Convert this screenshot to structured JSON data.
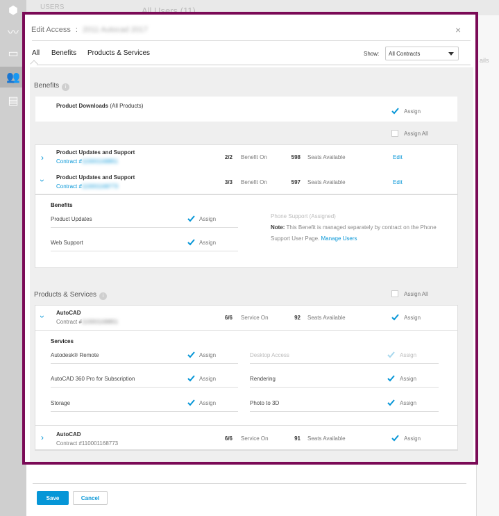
{
  "background": {
    "users_label": "USERS",
    "all_users_label": "All Users (11)",
    "right_col_text": "ails"
  },
  "dialog": {
    "title": "Edit Access",
    "title_sep": ":",
    "title_suffix": "2011 Autocad 2017",
    "close": "×",
    "tabs": [
      "All",
      "Benefits",
      "Products & Services"
    ],
    "show_label": "Show:",
    "show_value": "All Contracts"
  },
  "benefits": {
    "heading": "Benefits",
    "downloads_name": "Product Downloads",
    "downloads_suffix": " (All Products)",
    "assign_label": "Assign",
    "assign_all_label": "Assign All",
    "rows": [
      {
        "name": "Product Updates and Support",
        "contract_prefix": "Contract #",
        "contract_num": "110001168851",
        "count": "2/2",
        "status": "Benefit On",
        "seats": "598",
        "seats_label": "Seats Available",
        "action": "Edit"
      },
      {
        "name": "Product Updates and Support",
        "contract_prefix": "Contract #",
        "contract_num": "110001168773",
        "count": "3/3",
        "status": "Benefit On",
        "seats": "597",
        "seats_label": "Seats Available",
        "action": "Edit"
      }
    ],
    "detail": {
      "title": "Benefits",
      "items": [
        {
          "label": "Product Updates",
          "assign": "Assign"
        },
        {
          "label": "Web Support",
          "assign": "Assign"
        }
      ],
      "phone_support": "Phone Support (Assigned)",
      "note_bold": "Note:",
      "note_text": " This Benefit is managed separately by contract on the Phone Support User Page. ",
      "note_link": "Manage Users"
    }
  },
  "products": {
    "heading": "Products & Services",
    "assign_all_label": "Assign All",
    "rows": [
      {
        "name": "AutoCAD",
        "contract_prefix": "Contract #",
        "contract_num": "110001168851",
        "count": "6/6",
        "status": "Service On",
        "seats": "92",
        "seats_label": "Seats Available",
        "assign": "Assign"
      },
      {
        "name": "AutoCAD",
        "contract_prefix": "Contract #110001168773",
        "count": "6/6",
        "status": "Service On",
        "seats": "91",
        "seats_label": "Seats Available",
        "assign": "Assign"
      }
    ],
    "services": {
      "title": "Services",
      "left": [
        {
          "label": "Autodesk® Remote",
          "assign": "Assign"
        },
        {
          "label": "AutoCAD 360 Pro for Subscription",
          "assign": "Assign"
        },
        {
          "label": "Storage",
          "assign": "Assign"
        }
      ],
      "right": [
        {
          "label": "Desktop Access",
          "assign": "Assign",
          "disabled": true
        },
        {
          "label": "Rendering",
          "assign": "Assign"
        },
        {
          "label": "Photo to 3D",
          "assign": "Assign"
        }
      ]
    }
  },
  "footer": {
    "save": "Save",
    "cancel": "Cancel"
  },
  "colors": {
    "accent": "#0696d7",
    "frame": "#7a0a56"
  }
}
